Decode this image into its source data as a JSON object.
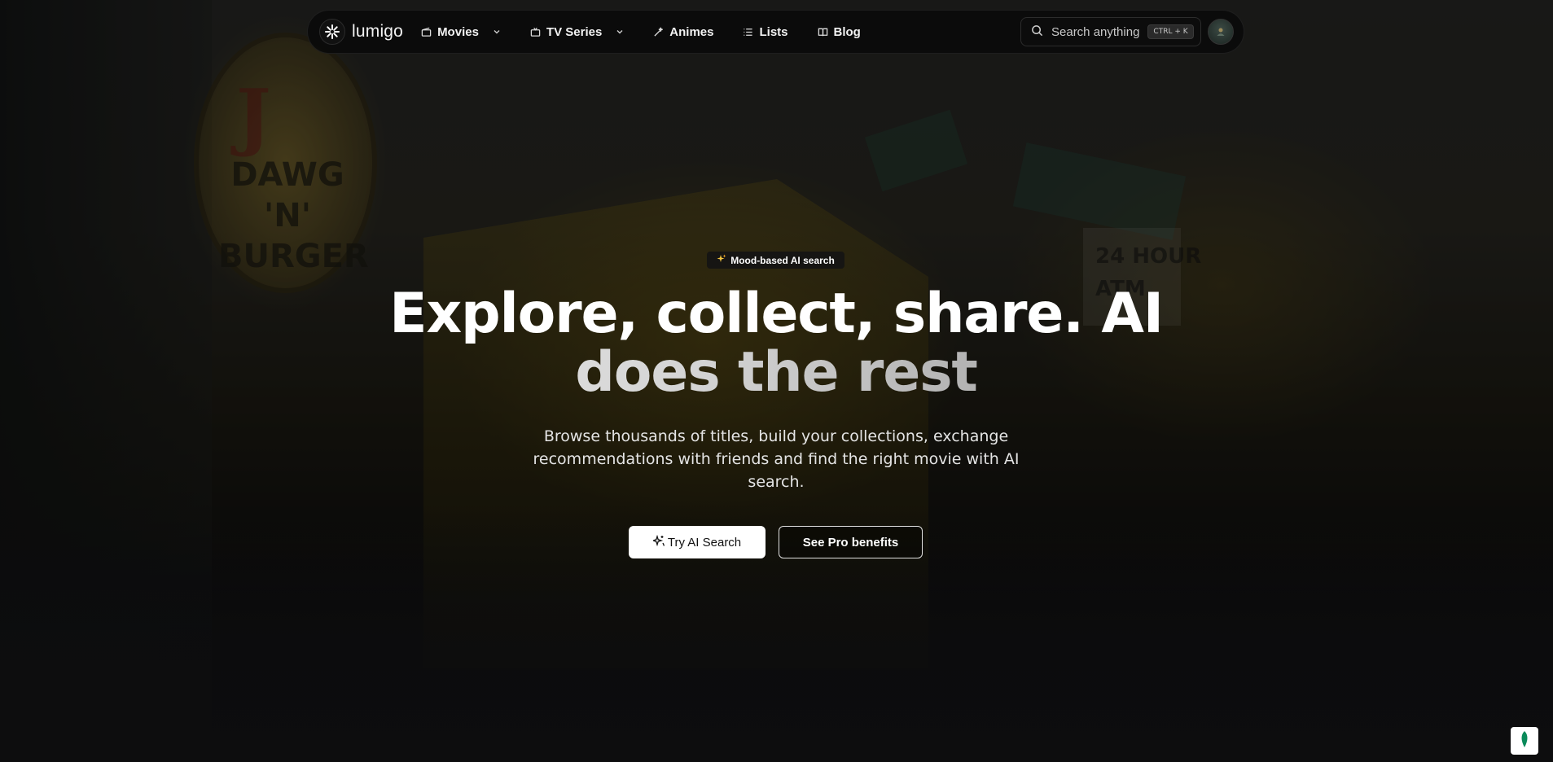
{
  "brand": {
    "name": "lumigo"
  },
  "nav": {
    "items": [
      {
        "label": "Movies",
        "icon": "film-icon",
        "has_dropdown": true
      },
      {
        "label": "TV Series",
        "icon": "tv-icon",
        "has_dropdown": true
      },
      {
        "label": "Animes",
        "icon": "wand-icon",
        "has_dropdown": false
      },
      {
        "label": "Lists",
        "icon": "list-icon",
        "has_dropdown": false
      },
      {
        "label": "Blog",
        "icon": "book-icon",
        "has_dropdown": false
      }
    ]
  },
  "search": {
    "placeholder": "Search anything",
    "shortcut": "CTRL + K"
  },
  "hero": {
    "badge": "Mood-based AI search",
    "title_line1": "Explore, collect, share. AI",
    "title_line2": "does the rest",
    "subtitle": "Browse thousands of titles, build your collections, exchange recommendations with friends and find the right movie with AI search.",
    "primary_button": "Try AI Search",
    "secondary_button": "See Pro benefits"
  },
  "colors": {
    "accent_widget": "#0a8a5a",
    "button_primary_bg": "#ffffff",
    "navbar_bg": "#0a0a0a"
  }
}
